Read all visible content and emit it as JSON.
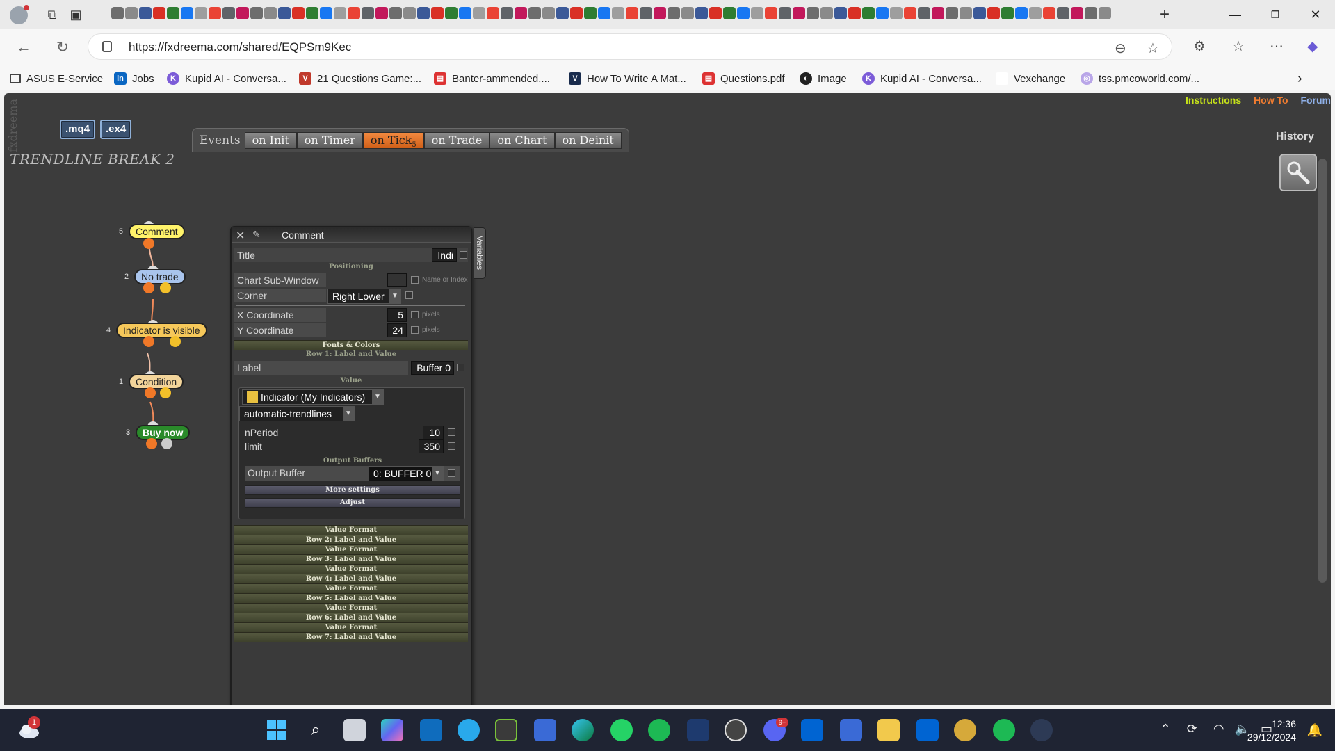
{
  "browser": {
    "url": "https://fxdreema.com/shared/EQPSm9Kec",
    "bookmarks": [
      {
        "label": "ASUS E-Service"
      },
      {
        "label": "Jobs"
      },
      {
        "label": "Kupid AI - Conversa..."
      },
      {
        "label": "21 Questions Game:..."
      },
      {
        "label": "Banter-ammended...."
      },
      {
        "label": "How To Write A Mat..."
      },
      {
        "label": "Questions.pdf"
      },
      {
        "label": "Image"
      },
      {
        "label": "Kupid AI - Conversa..."
      },
      {
        "label": "Vexchange"
      },
      {
        "label": "tss.pmcoworld.com/..."
      }
    ]
  },
  "app": {
    "brand": "fxdreema",
    "export_buttons": [
      ".mq4",
      ".ex4"
    ],
    "project_title": "TRENDLINE BREAK 2",
    "top_links": {
      "instructions": "Instructions",
      "how_to": "How To",
      "forum": "Forum"
    },
    "history": "History",
    "events": {
      "label": "Events",
      "tabs": [
        {
          "label": "on Init"
        },
        {
          "label": "on Timer"
        },
        {
          "label": "on Tick",
          "count": "5",
          "active": true
        },
        {
          "label": "on Trade"
        },
        {
          "label": "on Chart"
        },
        {
          "label": "on Deinit"
        }
      ]
    },
    "nodes": [
      {
        "num": "5",
        "label": "Comment",
        "color": "#fff36a"
      },
      {
        "num": "2",
        "label": "No trade",
        "color": "#a9c4ec"
      },
      {
        "num": "4",
        "label": "Indicator is visible",
        "color": "#f6c85a"
      },
      {
        "num": "1",
        "label": "Condition",
        "color": "#f2d49a"
      },
      {
        "num": "3",
        "label": "Buy now",
        "color": "#2a8a2a"
      }
    ],
    "panel": {
      "title": "Comment",
      "variables_tab": "Variables",
      "title_row": {
        "label": "Title",
        "value": "Indi"
      },
      "positioning_header": "Positioning",
      "chart_subwindow": {
        "label": "Chart Sub-Window",
        "value": "",
        "hint": "Name or Index"
      },
      "corner": {
        "label": "Corner",
        "value": "Right Lower"
      },
      "x_coord": {
        "label": "X Coordinate",
        "value": "5",
        "unit": "pixels"
      },
      "y_coord": {
        "label": "Y Coordinate",
        "value": "24",
        "unit": "pixels"
      },
      "fonts_colors": "Fonts & Colors",
      "row1_header": "Row 1: Label and Value",
      "label_row": {
        "label": "Label",
        "value": "Buffer 0"
      },
      "value_header": "Value",
      "source_select": "Indicator (My Indicators)",
      "indicator_select": "automatic-trendlines",
      "params": [
        {
          "label": "nPeriod",
          "value": "10"
        },
        {
          "label": "limit",
          "value": "350"
        }
      ],
      "output_buffers_header": "Output Buffers",
      "output_buffer": {
        "label": "Output Buffer",
        "value": "0: BUFFER 0"
      },
      "more_settings": "More settings",
      "adjust": "Adjust",
      "bottom_bars": [
        "Value Format",
        "Row 2: Label and Value",
        "Value Format",
        "Row 3: Label and Value",
        "Value Format",
        "Row 4: Label and Value",
        "Value Format",
        "Row 5: Label and Value",
        "Value Format",
        "Row 6: Label and Value",
        "Value Format",
        "Row 7: Label and Value"
      ]
    }
  },
  "taskbar": {
    "weather_badge": "1",
    "discord_badge": "9+",
    "time": "12:36",
    "date": "29/12/2024"
  },
  "colors": {
    "app_bg": "#3c3c3c",
    "active_tab": "#e27328",
    "instructions_link": "#c6e21a",
    "howto_link": "#f07c30",
    "forum_link": "#8fb0e8"
  }
}
